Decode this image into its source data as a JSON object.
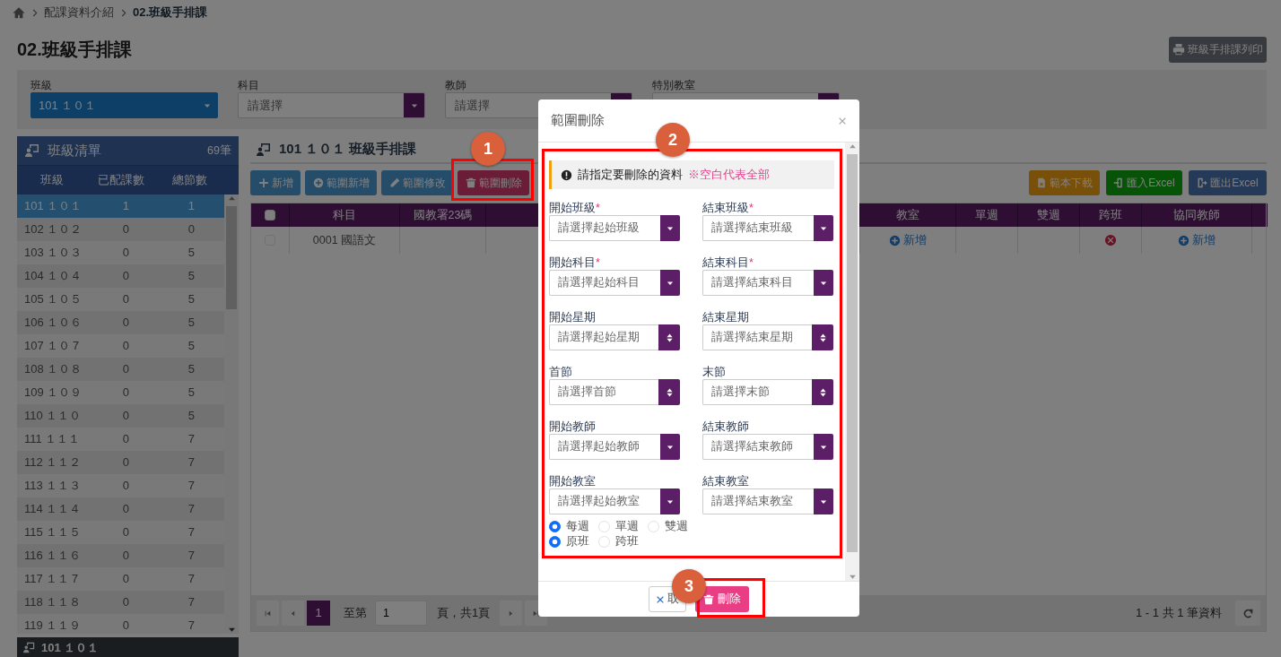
{
  "breadcrumb": [
    {
      "label": "配課資料介紹",
      "current": false
    },
    {
      "label": "02.班級手排課",
      "current": true
    }
  ],
  "page_title": "02.班級手排課",
  "print_button": "班級手排課列印",
  "filters": [
    {
      "label": "班級",
      "value": "101 １０１",
      "kind": "highlighted"
    },
    {
      "label": "科目",
      "value": "請選擇",
      "kind": "plain"
    },
    {
      "label": "教師",
      "value": "請選擇",
      "kind": "plain"
    },
    {
      "label": "特別教室",
      "kind": "plain"
    }
  ],
  "class_list": {
    "title": "班級清單",
    "count": "69筆",
    "columns": [
      "班級",
      "已配課數",
      "總節數"
    ],
    "rows": [
      {
        "cells": [
          "101 １０１",
          "1",
          "1"
        ],
        "selected": true
      },
      {
        "cells": [
          "102 １０２",
          "0",
          "0"
        ],
        "selected": false
      },
      {
        "cells": [
          "103 １０３",
          "0",
          "5"
        ],
        "selected": false
      },
      {
        "cells": [
          "104 １０４",
          "0",
          "5"
        ],
        "selected": false
      },
      {
        "cells": [
          "105 １０５",
          "0",
          "5"
        ],
        "selected": false
      },
      {
        "cells": [
          "106 １０６",
          "0",
          "5"
        ],
        "selected": false
      },
      {
        "cells": [
          "107 １０７",
          "0",
          "5"
        ],
        "selected": false
      },
      {
        "cells": [
          "108 １０８",
          "0",
          "5"
        ],
        "selected": false
      },
      {
        "cells": [
          "109 １０９",
          "0",
          "5"
        ],
        "selected": false
      },
      {
        "cells": [
          "110 １１０",
          "0",
          "5"
        ],
        "selected": false
      },
      {
        "cells": [
          "111 １１１",
          "0",
          "7"
        ],
        "selected": false
      },
      {
        "cells": [
          "112 １１２",
          "0",
          "7"
        ],
        "selected": false
      },
      {
        "cells": [
          "113 １１３",
          "0",
          "7"
        ],
        "selected": false
      },
      {
        "cells": [
          "114 １１４",
          "0",
          "7"
        ],
        "selected": false
      },
      {
        "cells": [
          "115 １１５",
          "0",
          "7"
        ],
        "selected": false
      },
      {
        "cells": [
          "116 １１６",
          "0",
          "7"
        ],
        "selected": false
      },
      {
        "cells": [
          "117 １１７",
          "0",
          "7"
        ],
        "selected": false
      },
      {
        "cells": [
          "118 １１８",
          "0",
          "7"
        ],
        "selected": false
      },
      {
        "cells": [
          "119 １１９",
          "0",
          "7"
        ],
        "selected": false
      }
    ],
    "footer": "101 １０１"
  },
  "schedule": {
    "title": "101 １０１ 班級手排課",
    "actions": [
      {
        "label": "新增",
        "kind": "add"
      },
      {
        "label": "範圍新增",
        "kind": "rangeadd"
      },
      {
        "label": "範圍修改",
        "kind": "edit"
      },
      {
        "label": "範圍刪除",
        "kind": "delete"
      }
    ],
    "file_actions": [
      {
        "label": "範本下載",
        "kind": "template"
      },
      {
        "label": "匯入Excel",
        "kind": "import"
      },
      {
        "label": "匯出Excel",
        "kind": "export"
      }
    ],
    "all_checked": false,
    "columns": [
      "科目",
      "國教署23碼",
      "教室",
      "單週",
      "雙週",
      "跨班",
      "協同教師"
    ],
    "rows": [
      {
        "checked": false,
        "subject": "0001 國語文",
        "classroom_link": "新增",
        "cross_class": false,
        "co_teacher_link": "新增"
      }
    ],
    "pager": {
      "current_page": "1",
      "goto_label": "至第",
      "goto_value": "1",
      "page_total": "頁，共1頁",
      "summary": "1 - 1 共 1 筆資料"
    }
  },
  "modal": {
    "title": "範圍刪除",
    "notice": "請指定要刪除的資料",
    "notice_hint": "※空白代表全部",
    "fields": [
      {
        "label": "開始班級",
        "required_mark": "*",
        "placeholder": "請選擇起始班級",
        "kind": "select"
      },
      {
        "label": "結束班級",
        "required_mark": "*",
        "placeholder": "請選擇結束班級",
        "kind": "select"
      },
      {
        "label": "開始科目",
        "required_mark": "*",
        "placeholder": "請選擇起始科目",
        "kind": "select"
      },
      {
        "label": "結束科目",
        "required_mark": "*",
        "placeholder": "請選擇結束科目",
        "kind": "select"
      },
      {
        "label": "開始星期",
        "placeholder": "請選擇起始星期",
        "kind": "spinner"
      },
      {
        "label": "結束星期",
        "placeholder": "請選擇結束星期",
        "kind": "spinner"
      },
      {
        "label": "首節",
        "placeholder": "請選擇首節",
        "kind": "spinner"
      },
      {
        "label": "末節",
        "placeholder": "請選擇末節",
        "kind": "spinner"
      },
      {
        "label": "開始教師",
        "placeholder": "請選擇起始教師",
        "kind": "select"
      },
      {
        "label": "結束教師",
        "placeholder": "請選擇結束教師",
        "kind": "select"
      },
      {
        "label": "開始教室",
        "placeholder": "請選擇起始教室",
        "kind": "select"
      },
      {
        "label": "結束教室",
        "placeholder": "請選擇結束教室",
        "kind": "select"
      }
    ],
    "radio_groups": [
      [
        {
          "label": "每週",
          "selected": true
        },
        {
          "label": "單週",
          "selected": false
        },
        {
          "label": "雙週",
          "selected": false
        }
      ],
      [
        {
          "label": "原班",
          "selected": true
        },
        {
          "label": "跨班",
          "selected": false
        }
      ]
    ],
    "buttons": [
      {
        "label": "取",
        "kind": "cancel"
      },
      {
        "label": "刪除",
        "kind": "delete"
      }
    ]
  },
  "annotations": [
    {
      "number": "1"
    },
    {
      "number": "2"
    },
    {
      "number": "3"
    }
  ]
}
